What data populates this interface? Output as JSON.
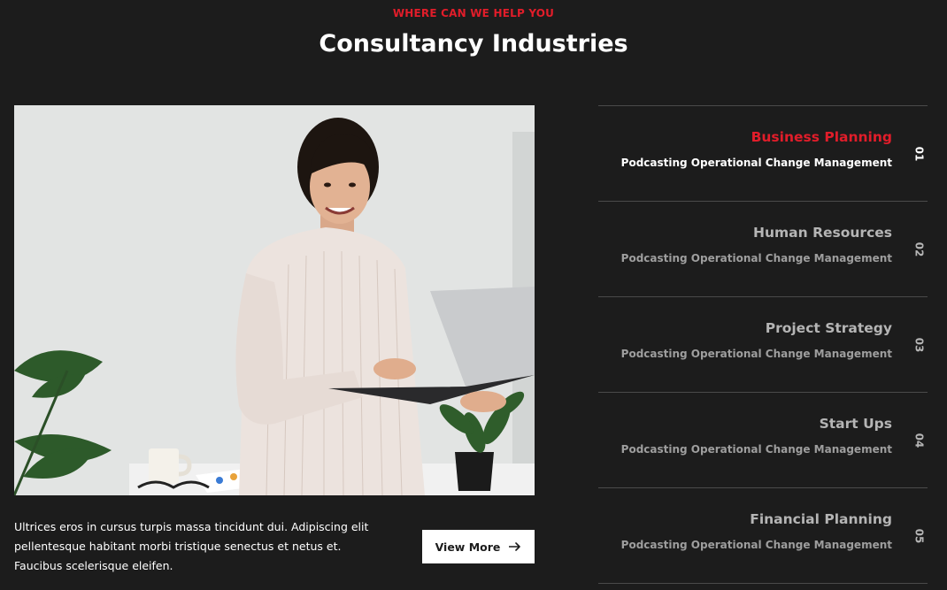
{
  "section": {
    "eyebrow": "WHERE CAN WE HELP YOU",
    "heading": "Consultancy Industries"
  },
  "feature": {
    "description": "Ultrices eros in cursus turpis massa tincidunt dui. Adipiscing elit pellentesque habitant morbi tristique senectus et netus et. Faucibus scelerisque eleifen.",
    "button_label": "View More"
  },
  "industries": [
    {
      "title": "Business Planning",
      "subtitle": "Podcasting Operational Change Management",
      "number": "01",
      "active": true
    },
    {
      "title": "Human Resources",
      "subtitle": "Podcasting Operational Change Management",
      "number": "02",
      "active": false
    },
    {
      "title": "Project Strategy",
      "subtitle": "Podcasting Operational Change Management",
      "number": "03",
      "active": false
    },
    {
      "title": "Start Ups",
      "subtitle": "Podcasting Operational Change Management",
      "number": "04",
      "active": false
    },
    {
      "title": "Financial Planning",
      "subtitle": "Podcasting Operational Change Management",
      "number": "05",
      "active": false
    }
  ],
  "colors": {
    "background": "#1c1c1c",
    "accent": "#e11d2a",
    "divider": "#4a4a4a"
  },
  "icons": {
    "button_arrow": "arrow-right-icon"
  }
}
